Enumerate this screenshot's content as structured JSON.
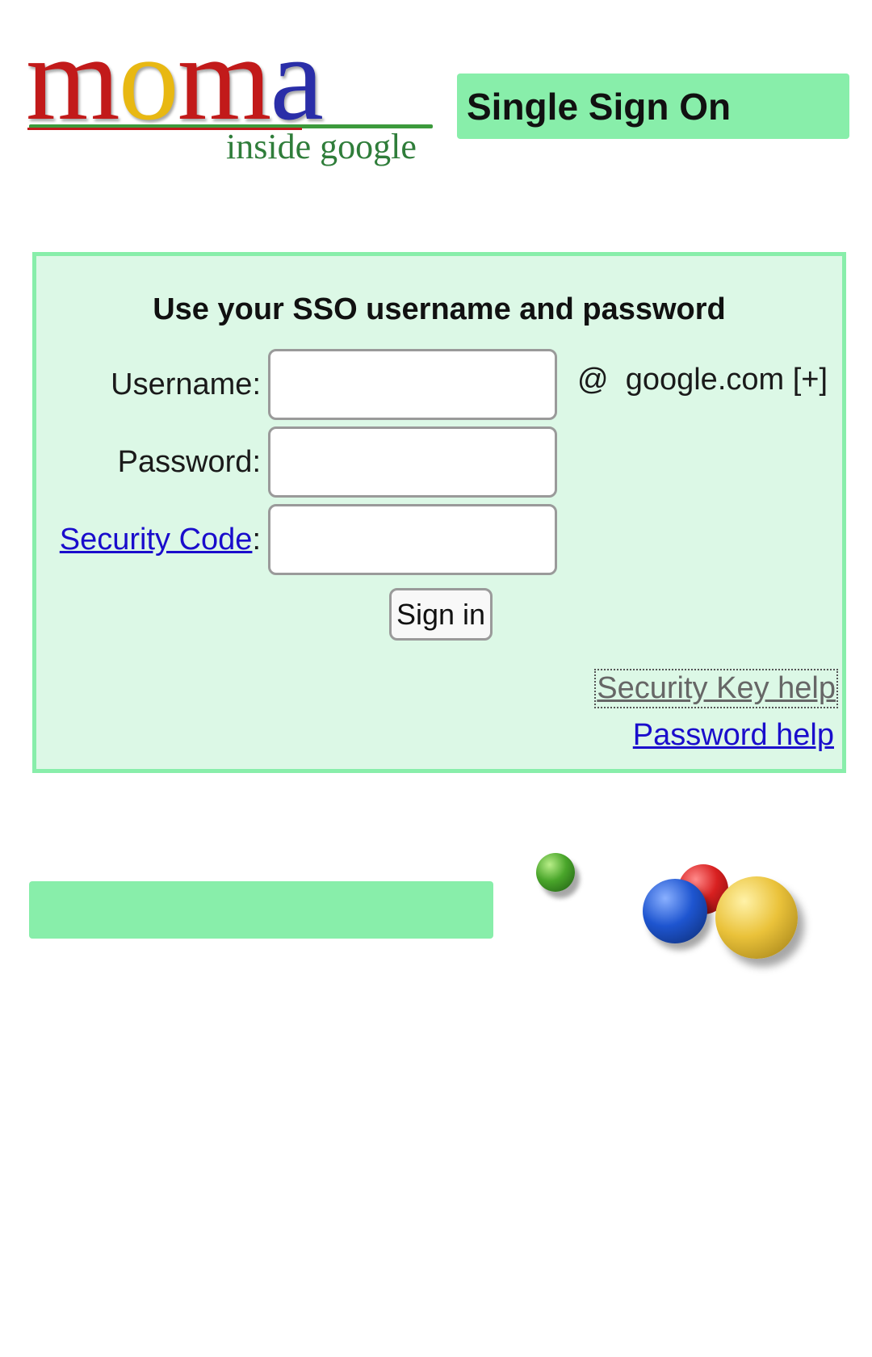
{
  "logo": {
    "word_m1": "m",
    "word_o1": "o",
    "word_m2": "m",
    "word_a": "a",
    "subtitle": "inside google",
    "colors": {
      "m": "#c21a1a",
      "o": "#e8b812",
      "a": "#2a2ea8",
      "subtitle": "#2f7d3a"
    }
  },
  "header": {
    "title": "Single Sign On",
    "banner_color": "#88eeaa"
  },
  "login": {
    "heading": "Use your SSO username and password",
    "username_label": "Username:",
    "username_value": "",
    "password_label": "Password:",
    "password_value": "",
    "security_code_link": "Security Code",
    "security_code_colon": ":",
    "security_code_value": "",
    "domain_at": "@",
    "domain": "google.com",
    "domain_expand": "[+]",
    "signin_label": "Sign in",
    "security_key_help": "Security Key help",
    "password_help": "Password help",
    "box_color": "#dcf8e6",
    "link_color": "#1a0dcc"
  },
  "footer": {
    "bar_color": "#88eeaa",
    "decorations": [
      "green-ball-icon",
      "red-ball-icon",
      "blue-ball-icon",
      "yellow-ball-icon"
    ]
  }
}
